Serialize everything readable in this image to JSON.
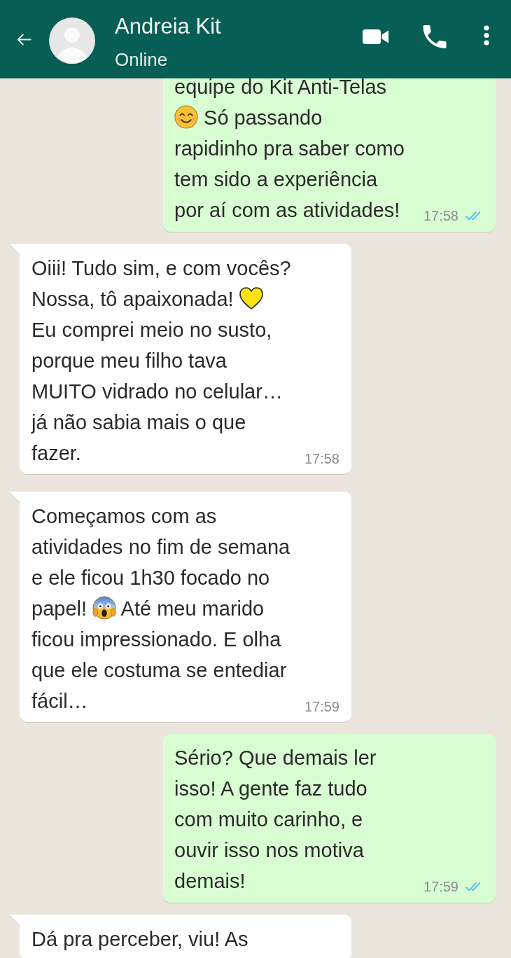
{
  "contact": {
    "name": "Andreia Kit",
    "status": "Online"
  },
  "messages": [
    {
      "kind": "outgoing",
      "lines": [
        "equipe do Kit Anti-Telas",
        [
          {
            "kind": "smile"
          },
          "Só passando"
        ],
        "rapidinho pra saber como",
        "tem sido a experiência",
        "por aí com as atividades!"
      ],
      "time": "17:58",
      "read": true
    },
    {
      "kind": "incoming",
      "lines": [
        "Oiii! Tudo sim, e com vocês?",
        [
          "Nossa, tô apaixonada!",
          {
            "kind": "heart"
          }
        ],
        "Eu comprei meio no susto,",
        "porque meu filho tava",
        "MUITO vidrado no celular…",
        "já não sabia mais o que",
        "fazer."
      ],
      "time": "17:58"
    },
    {
      "kind": "incoming",
      "lines": [
        "Começamos com as",
        "atividades no fim de semana",
        "e ele ficou 1h30 focado no",
        [
          "papel!",
          {
            "kind": "scream"
          },
          "Até meu marido"
        ],
        "ficou impressionado. E olha",
        "que ele costuma se entediar",
        "fácil…"
      ],
      "time": "17:59"
    },
    {
      "kind": "outgoing",
      "lines": [
        "Sério? Que demais ler",
        "isso! A gente faz tudo",
        "com muito carinho, e",
        "ouvir isso nos motiva",
        "demais!"
      ],
      "time": "17:59",
      "read": true
    },
    {
      "kind": "incoming",
      "lines": [
        "Dá pra perceber, viu! As"
      ]
    }
  ]
}
